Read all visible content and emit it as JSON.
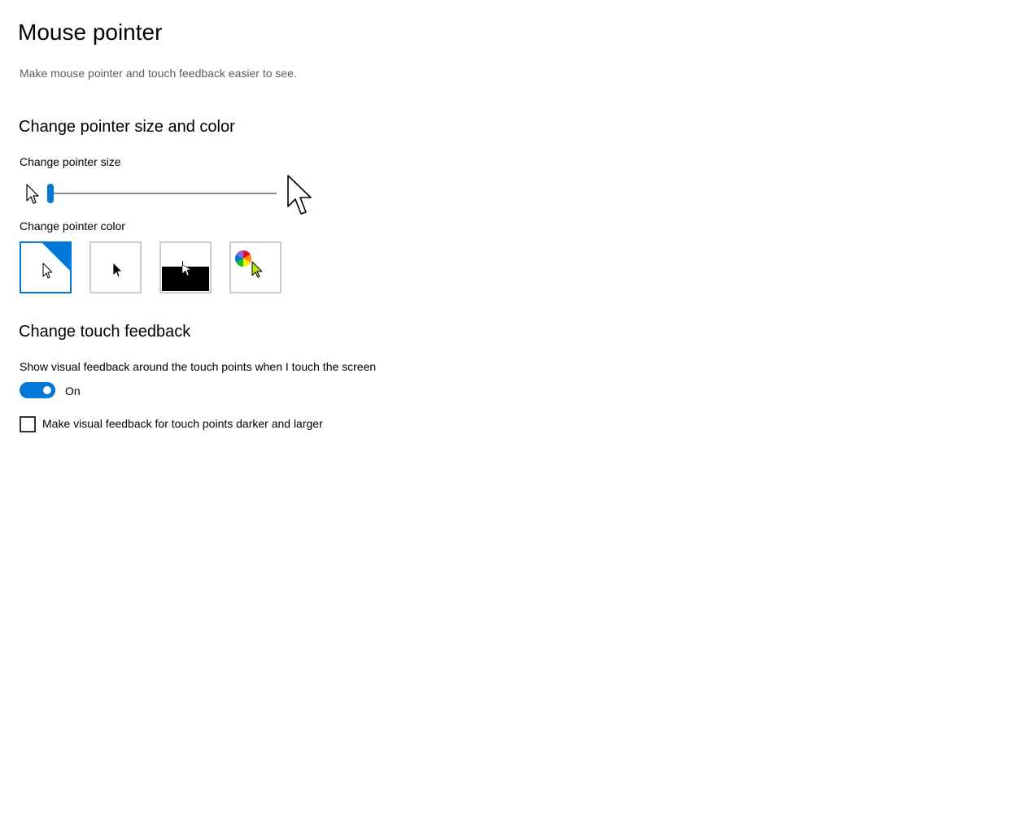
{
  "page": {
    "title": "Mouse pointer",
    "description": "Make mouse pointer and touch feedback easier to see."
  },
  "pointer_section": {
    "title": "Change pointer size and color",
    "size_label": "Change pointer size",
    "size_value_fraction": 0.0,
    "color_label": "Change pointer color",
    "color_options": [
      {
        "name": "white",
        "selected": true
      },
      {
        "name": "black",
        "selected": false
      },
      {
        "name": "inverted",
        "selected": false
      },
      {
        "name": "custom",
        "selected": false
      }
    ],
    "custom_cursor_color": "#b4e61e"
  },
  "touch_section": {
    "title": "Change touch feedback",
    "feedback_label": "Show visual feedback around the touch points when I touch the screen",
    "toggle_state": "On",
    "toggle_on": true,
    "darker_larger_label": "Make visual feedback for touch points darker and larger",
    "darker_larger_checked": false
  },
  "colors": {
    "accent": "#0078d7"
  }
}
